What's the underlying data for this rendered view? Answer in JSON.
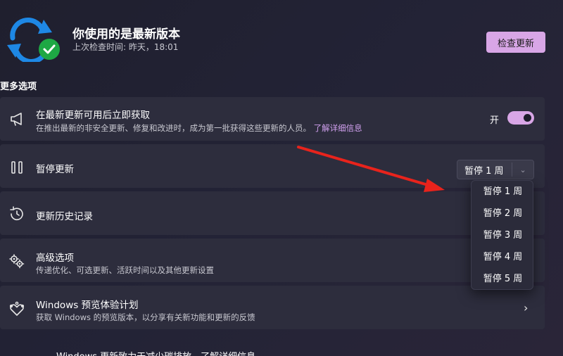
{
  "header": {
    "title": "你使用的是最新版本",
    "subtitle": "上次检查时间: 昨天，18:01",
    "check_button": "检查更新"
  },
  "section_title": "更多选项",
  "cards": {
    "latest": {
      "title": "在最新更新可用后立即获取",
      "desc": "在推出最新的非安全更新、修复和改进时，成为第一批获得这些更新的人员。",
      "link": "了解详细信息",
      "toggle_label": "开",
      "toggle_on": true
    },
    "pause": {
      "title": "暂停更新",
      "selected": "暂停 1 周",
      "options": [
        "暂停 1 周",
        "暂停 2 周",
        "暂停 3 周",
        "暂停 4 周",
        "暂停 5 周"
      ]
    },
    "history": {
      "title": "更新历史记录"
    },
    "advanced": {
      "title": "高级选项",
      "desc": "传递优化、可选更新、活跃时间以及其他更新设置"
    },
    "insider": {
      "title": "Windows 预览体验计划",
      "desc": "获取 Windows 的预览版本，以分享有关新功能和更新的反馈"
    }
  },
  "bottom_text": "Windows 更新致力于减少碳排放。了解详细信息",
  "colors": {
    "accent": "#d8a6e6",
    "card_bg": "#2d2d3d",
    "arrow": "#e8231c",
    "sync_blue": "#1e88e5",
    "check_green": "#1ea844"
  }
}
